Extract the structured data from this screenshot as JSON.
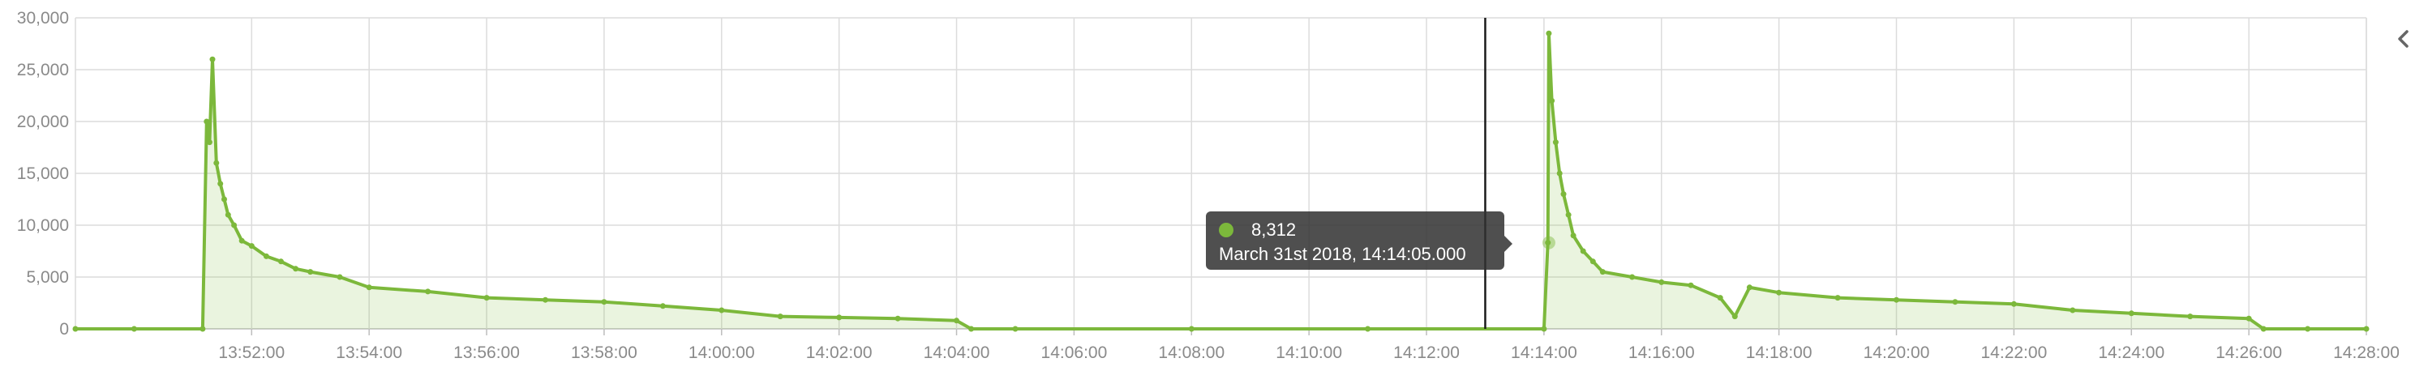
{
  "chart_data": {
    "type": "area",
    "x_format": "HH:MM:SS",
    "x_range": [
      "13:49:00",
      "14:28:00"
    ],
    "ylim": [
      0,
      30000
    ],
    "y_ticks": [
      "0",
      "5,000",
      "10,000",
      "15,000",
      "20,000",
      "25,000",
      "30,000"
    ],
    "y_tick_values": [
      0,
      5000,
      10000,
      15000,
      20000,
      25000,
      30000
    ],
    "x_ticks": [
      "13:52:00",
      "13:54:00",
      "13:56:00",
      "13:58:00",
      "14:00:00",
      "14:02:00",
      "14:04:00",
      "14:06:00",
      "14:08:00",
      "14:10:00",
      "14:12:00",
      "14:14:00",
      "14:16:00",
      "14:18:00",
      "14:20:00",
      "14:22:00",
      "14:24:00",
      "14:26:00",
      "14:28:00"
    ],
    "grid": true,
    "legend": "none",
    "series": [
      {
        "color": "#7cb83b",
        "x": [
          "13:49:00",
          "13:50:00",
          "13:51:10",
          "13:51:14",
          "13:51:17",
          "13:51:20",
          "13:51:24",
          "13:51:28",
          "13:51:32",
          "13:51:36",
          "13:51:42",
          "13:51:50",
          "13:52:00",
          "13:52:15",
          "13:52:30",
          "13:52:45",
          "13:53:00",
          "13:53:30",
          "13:54:00",
          "13:55:00",
          "13:56:00",
          "13:57:00",
          "13:58:00",
          "13:59:00",
          "14:00:00",
          "14:01:00",
          "14:02:00",
          "14:03:00",
          "14:04:00",
          "14:04:15",
          "14:05:00",
          "14:08:00",
          "14:11:00",
          "14:14:00",
          "14:14:04",
          "14:14:05",
          "14:14:08",
          "14:14:12",
          "14:14:16",
          "14:14:20",
          "14:14:25",
          "14:14:30",
          "14:14:40",
          "14:14:50",
          "14:15:00",
          "14:15:30",
          "14:16:00",
          "14:16:30",
          "14:17:00",
          "14:17:15",
          "14:17:30",
          "14:18:00",
          "14:19:00",
          "14:20:00",
          "14:21:00",
          "14:22:00",
          "14:23:00",
          "14:24:00",
          "14:25:00",
          "14:26:00",
          "14:26:15",
          "14:27:00",
          "14:28:00"
        ],
        "y": [
          0,
          0,
          0,
          20000,
          18000,
          26000,
          16000,
          14000,
          12500,
          11000,
          10000,
          8500,
          8000,
          7000,
          6500,
          5800,
          5500,
          5000,
          4000,
          3600,
          3000,
          2800,
          2600,
          2200,
          1800,
          1200,
          1100,
          1000,
          800,
          0,
          0,
          0,
          0,
          0,
          8312,
          28500,
          22000,
          18000,
          15000,
          13000,
          11000,
          9000,
          7500,
          6500,
          5500,
          5000,
          4500,
          4200,
          3000,
          1200,
          4000,
          3500,
          3000,
          2800,
          2600,
          2400,
          1800,
          1500,
          1200,
          1000,
          0,
          0,
          0
        ]
      }
    ],
    "crosshair_time": "14:13:00",
    "highlight_point": {
      "x": "14:14:05",
      "y": 8312
    }
  },
  "tooltip": {
    "value": "8,312",
    "label": "March 31st 2018, 14:14:05.000",
    "dot_color": "#7cb83b"
  },
  "ui": {
    "collapse_icon": "chevron-left-icon"
  }
}
